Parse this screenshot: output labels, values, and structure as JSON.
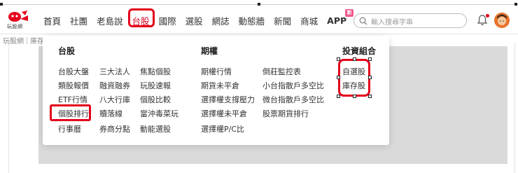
{
  "site": {
    "logo_text": "玩股網"
  },
  "nav": {
    "items": [
      "首頁",
      "社團",
      "老島說",
      "台股",
      "國際",
      "選股",
      "網誌",
      "動態牆",
      "新聞",
      "商城",
      "APP"
    ],
    "active_index": 3,
    "app_badge": "新"
  },
  "search": {
    "placeholder": "輸入搜尋字串"
  },
  "breadcrumb": {
    "home": "玩股網",
    "current": "庫存"
  },
  "dropdown": {
    "taiwan_heading": "台股",
    "taiwan_col1": [
      "台股大盤",
      "類股報價",
      "ETF行情",
      "個股排行",
      "行事曆"
    ],
    "taiwan_col2": [
      "三大法人",
      "融資融券",
      "八大行庫",
      "贖落線",
      "券商分點"
    ],
    "taiwan_col3": [
      "焦點個股",
      "玩股速報",
      "個股比較",
      "當沖毒菜玩",
      "動能選股"
    ],
    "options_heading": "期權",
    "options_col1": [
      "期權行情",
      "期貨未平倉",
      "選擇權支撐壓力",
      "選擇權未平倉",
      "選擇權P/C比"
    ],
    "options_col2": [
      "倒莊監控表",
      "小台指散戶多空比",
      "微台指散戶多空比",
      "股票期貨排行"
    ],
    "portfolio_heading": "投資組合",
    "portfolio_items": [
      "自選股",
      "庫存股"
    ]
  },
  "colors": {
    "accent_red": "#e4001b",
    "avatar": "#e9742b"
  }
}
